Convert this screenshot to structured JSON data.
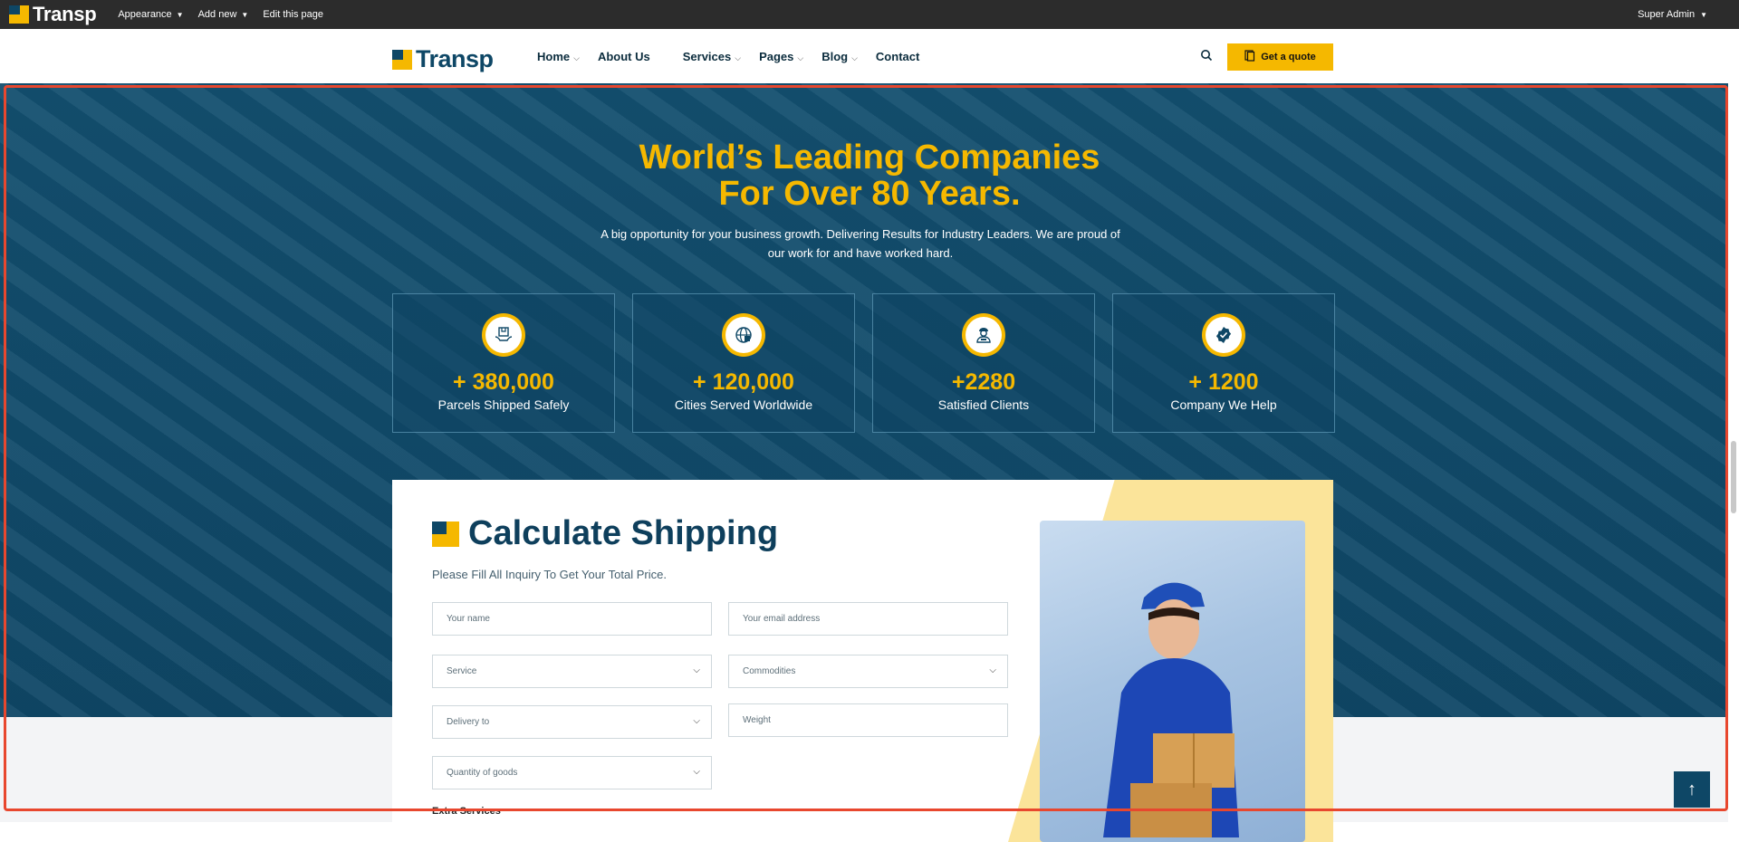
{
  "admin_bar": {
    "logo_text": "Transp",
    "menu": [
      {
        "label": "Appearance",
        "has_caret": true
      },
      {
        "label": "Add new",
        "has_caret": true
      },
      {
        "label": "Edit this page",
        "has_caret": false
      }
    ],
    "user": "Super Admin"
  },
  "header": {
    "brand": "Transp",
    "nav": [
      {
        "label": "Home",
        "has_dropdown": true
      },
      {
        "label": "About Us",
        "has_dropdown": false
      },
      {
        "label": "Services",
        "has_dropdown": true
      },
      {
        "label": "Pages",
        "has_dropdown": true
      },
      {
        "label": "Blog",
        "has_dropdown": true
      },
      {
        "label": "Contact",
        "has_dropdown": false
      }
    ],
    "search_icon": "search-icon",
    "quote_button": "Get a quote"
  },
  "hero": {
    "title_line1": "World’s Leading Companies",
    "title_line2": "For Over 80 Years.",
    "subtitle": "A big opportunity for your business growth. Delivering Results for Industry Leaders. We are proud of our work for and have worked hard.",
    "stats": [
      {
        "icon": "parcel-hands-icon",
        "value": "+ 380,000",
        "label": "Parcels Shipped Safely"
      },
      {
        "icon": "globe-icon",
        "value": "+ 120,000",
        "label": "Cities Served Worldwide"
      },
      {
        "icon": "client-icon",
        "value": "+2280",
        "label": "Satisfied Clients"
      },
      {
        "icon": "badge-check-icon",
        "value": "+ 1200",
        "label": "Company We Help"
      }
    ]
  },
  "calculator": {
    "title": "Calculate Shipping",
    "subtitle": "Please Fill All Inquiry To Get Your Total Price.",
    "fields": {
      "name": "Your name",
      "email": "Your email address",
      "service": "Service",
      "commodities": "Commodities",
      "delivery": "Delivery to",
      "weight": "Weight",
      "quantity": "Quantity of goods"
    },
    "extra_services": "Extra Services"
  },
  "colors": {
    "brand_navy": "#0e4766",
    "accent_yellow": "#f5b800",
    "highlight_frame": "#e8472e"
  }
}
